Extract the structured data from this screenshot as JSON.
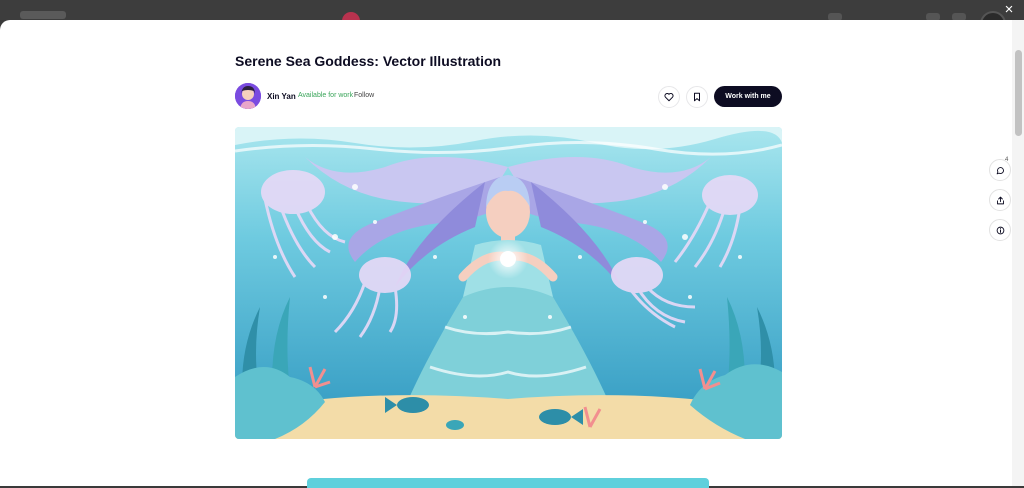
{
  "modal": {
    "close_label": "×"
  },
  "shot": {
    "title": "Serene Sea Goddess: Vector Illustration"
  },
  "author": {
    "name": "Xin Yan",
    "availability": "Available for work",
    "follow_label": "Follow"
  },
  "actions": {
    "like_icon": "heart-icon",
    "save_icon": "bookmark-icon",
    "work_label": "Work with me"
  },
  "sidebar": {
    "comments_count": "4",
    "comment_icon": "comment-icon",
    "share_icon": "share-icon",
    "info_icon": "info-icon"
  },
  "colors": {
    "accent_dark": "#0d0c22",
    "available_green": "#3aa55a",
    "sea_light": "#7fd6e3",
    "sea_deep": "#2f9fc4",
    "sand": "#f3dca8"
  }
}
